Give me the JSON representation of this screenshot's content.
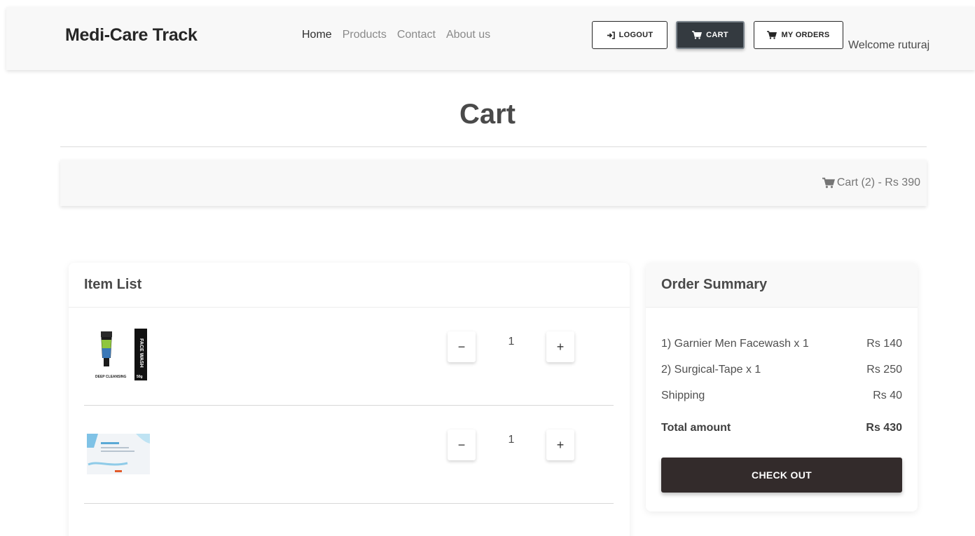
{
  "navbar": {
    "brand": "Medi-Care Track",
    "links": [
      "Home",
      "Products",
      "Contact",
      "About us"
    ],
    "logout_label": "LOGOUT",
    "cart_label": "CART",
    "orders_label": "MY ORDERS",
    "welcome": "Welcome ruturaj"
  },
  "page": {
    "title": "Cart",
    "cart_bar": "Cart (2) - Rs 390"
  },
  "item_list": {
    "heading": "Item List",
    "items": [
      {
        "name": "Garnier Men Facewash",
        "quantity": "1",
        "minus": "−",
        "plus": "+",
        "image": "facewash-product"
      },
      {
        "name": "Surgical-Tape",
        "quantity": "1",
        "minus": "−",
        "plus": "+",
        "image": "surgical-tape-box"
      }
    ],
    "facewash_pack_text": [
      "DEEP CLEANSING",
      "FACE WASH",
      "50g"
    ]
  },
  "order_summary": {
    "heading": "Order Summary",
    "lines": [
      {
        "label": "1) Garnier Men Facewash x 1",
        "amount": "Rs 140"
      },
      {
        "label": "2) Surgical-Tape x 1",
        "amount": "Rs 250"
      },
      {
        "label": "Shipping",
        "amount": "Rs 40"
      }
    ],
    "total_label": "Total amount",
    "total_amount": "Rs 430",
    "checkout_label": "CHECK OUT"
  },
  "colors": {
    "navbar_bg": "#f8f8f8",
    "dark_button": "#343a40",
    "checkout_button": "#332b2b"
  },
  "icons": [
    "login-icon",
    "cart-icon"
  ]
}
